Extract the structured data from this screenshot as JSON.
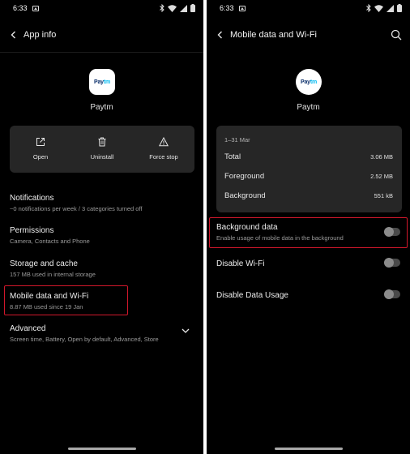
{
  "status_bar": {
    "time_left": "6:33",
    "time_right": "6:33"
  },
  "left": {
    "title": "App info",
    "app": {
      "name": "Paytm",
      "logo_part1": "Pay",
      "logo_part2": "tm"
    },
    "actions": [
      {
        "label": "Open",
        "icon": "open-external-icon"
      },
      {
        "label": "Uninstall",
        "icon": "trash-icon"
      },
      {
        "label": "Force stop",
        "icon": "warning-icon"
      }
    ],
    "items": [
      {
        "title": "Notifications",
        "subtitle": "~0 notifications per week / 3 categories turned off"
      },
      {
        "title": "Permissions",
        "subtitle": "Camera, Contacts and Phone"
      },
      {
        "title": "Storage and cache",
        "subtitle": "157 MB used in internal storage"
      },
      {
        "title": "Mobile data and Wi-Fi",
        "subtitle": "8.87 MB used since 19 Jan"
      },
      {
        "title": "Advanced",
        "subtitle": "Screen time, Battery, Open by default, Advanced, Store"
      }
    ]
  },
  "right": {
    "title": "Mobile data and Wi-Fi",
    "app": {
      "name": "Paytm",
      "logo_part1": "Pay",
      "logo_part2": "tm"
    },
    "usage": {
      "period": "1–31 Mar",
      "rows": [
        {
          "label": "Total",
          "value": "3.06 MB"
        },
        {
          "label": "Foreground",
          "value": "2.52 MB"
        },
        {
          "label": "Background",
          "value": "551 kB"
        }
      ]
    },
    "toggles": [
      {
        "title": "Background data",
        "subtitle": "Enable usage of mobile data in the background",
        "on": false
      },
      {
        "title": "Disable Wi-Fi",
        "subtitle": "",
        "on": false
      },
      {
        "title": "Disable Data Usage",
        "subtitle": "",
        "on": false
      }
    ]
  },
  "colors": {
    "highlight": "#d1172b",
    "card": "#262626",
    "background": "#000000"
  }
}
